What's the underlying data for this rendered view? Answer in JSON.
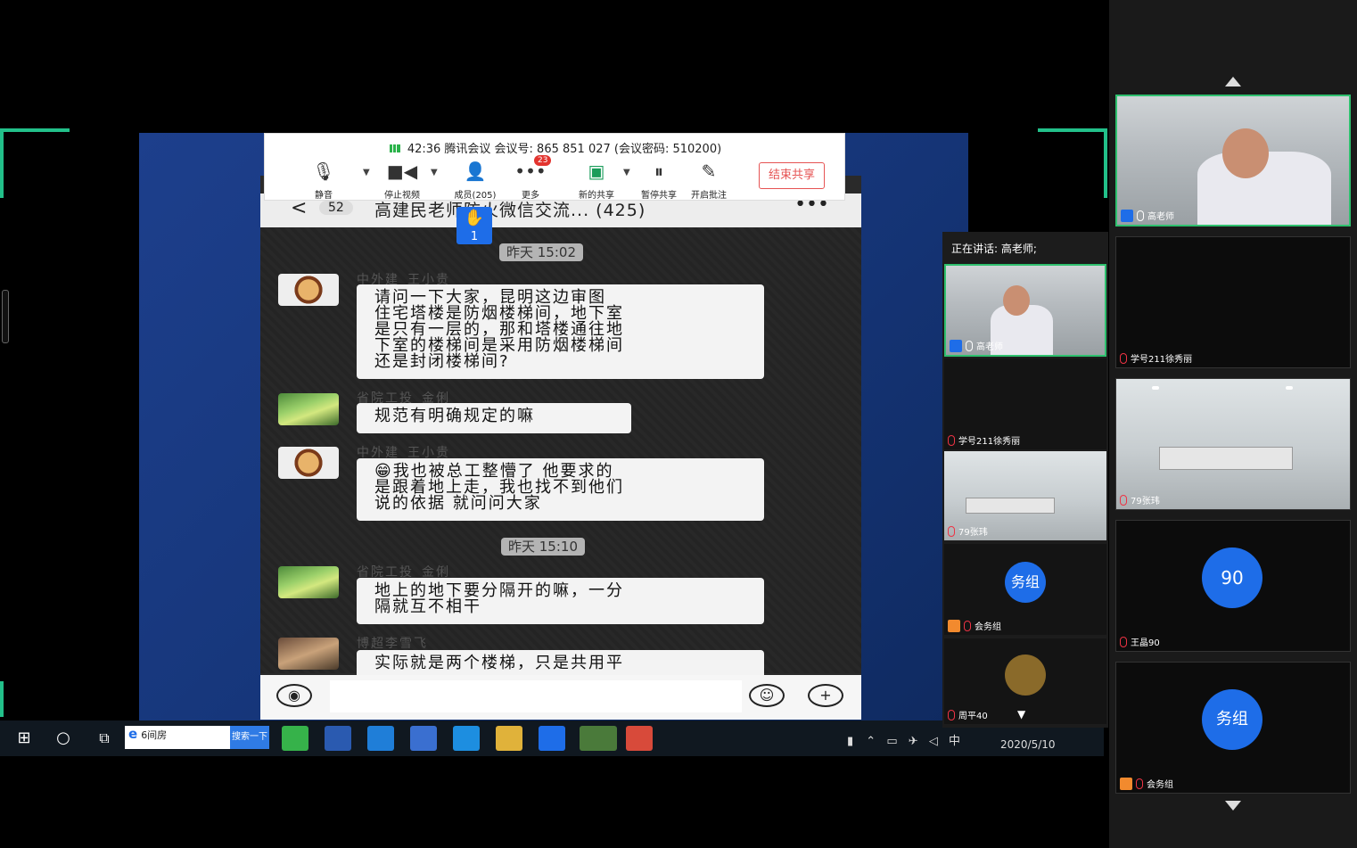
{
  "toolbar": {
    "info": "42:36   腾讯会议 会议号: 865 851 027  (会议密码: 510200)",
    "mute": "静音",
    "stop_video": "停止视频",
    "members": "成员(205)",
    "more": "更多",
    "more_badge": "23",
    "new_share": "新的共享",
    "pause_share": "暂停共享",
    "annotate": "开启批注",
    "end_share": "结束共享"
  },
  "raise_hand": {
    "count": "1"
  },
  "phone": {
    "back": "<",
    "unread": "52",
    "title": "高建民老师防火微信交流...  (425)",
    "more": "•••",
    "messages": [
      {
        "time": "昨天 15:02"
      },
      {
        "sender": "中外建_王小贵",
        "text": "请问一下大家，昆明这边审图\n住宅塔楼是防烟楼梯间，地下室\n是只有一层的，那和塔楼通往地\n下室的楼梯间是采用防烟楼梯间\n还是封闭楼梯间?"
      },
      {
        "sender": "省院工投_金俐",
        "text": "规范有明确规定的嘛"
      },
      {
        "sender": "中外建_王小贵",
        "text": "😁我也被总工整懵了 他要求的\n是跟着地上走，我也找不到他们\n说的依据 就问问大家"
      },
      {
        "time": "昨天 15:10"
      },
      {
        "sender": "省院工投_金俐",
        "text": "地上的地下要分隔开的嘛，一分\n隔就互不相干"
      },
      {
        "sender": "博超李雪飞",
        "text": "实际就是两个楼梯，只是共用平"
      }
    ]
  },
  "taskbar": {
    "search_text": "6间房",
    "search_button": "搜索一下",
    "tray_lang": "中",
    "date": "2020/5/10"
  },
  "strip": {
    "speaking": "正在讲话: 高老师;",
    "tiles": [
      {
        "name": "高老师"
      },
      {
        "name": "学号211徐秀丽"
      },
      {
        "name": "79张玮"
      },
      {
        "name": "会务组",
        "avatar_text": "务组"
      },
      {
        "name": "周平40"
      }
    ]
  },
  "sidebar": {
    "tiles": [
      {
        "name": "高老师"
      },
      {
        "name": "学号211徐秀丽"
      },
      {
        "name": "79张玮"
      },
      {
        "name": "王晶90",
        "avatar_text": "90"
      },
      {
        "name": "会务组",
        "avatar_text": "务组"
      }
    ]
  },
  "colors": {
    "accent_green": "#2ec06e",
    "brand_blue": "#1e6de8",
    "end_share_red": "#e65353"
  }
}
